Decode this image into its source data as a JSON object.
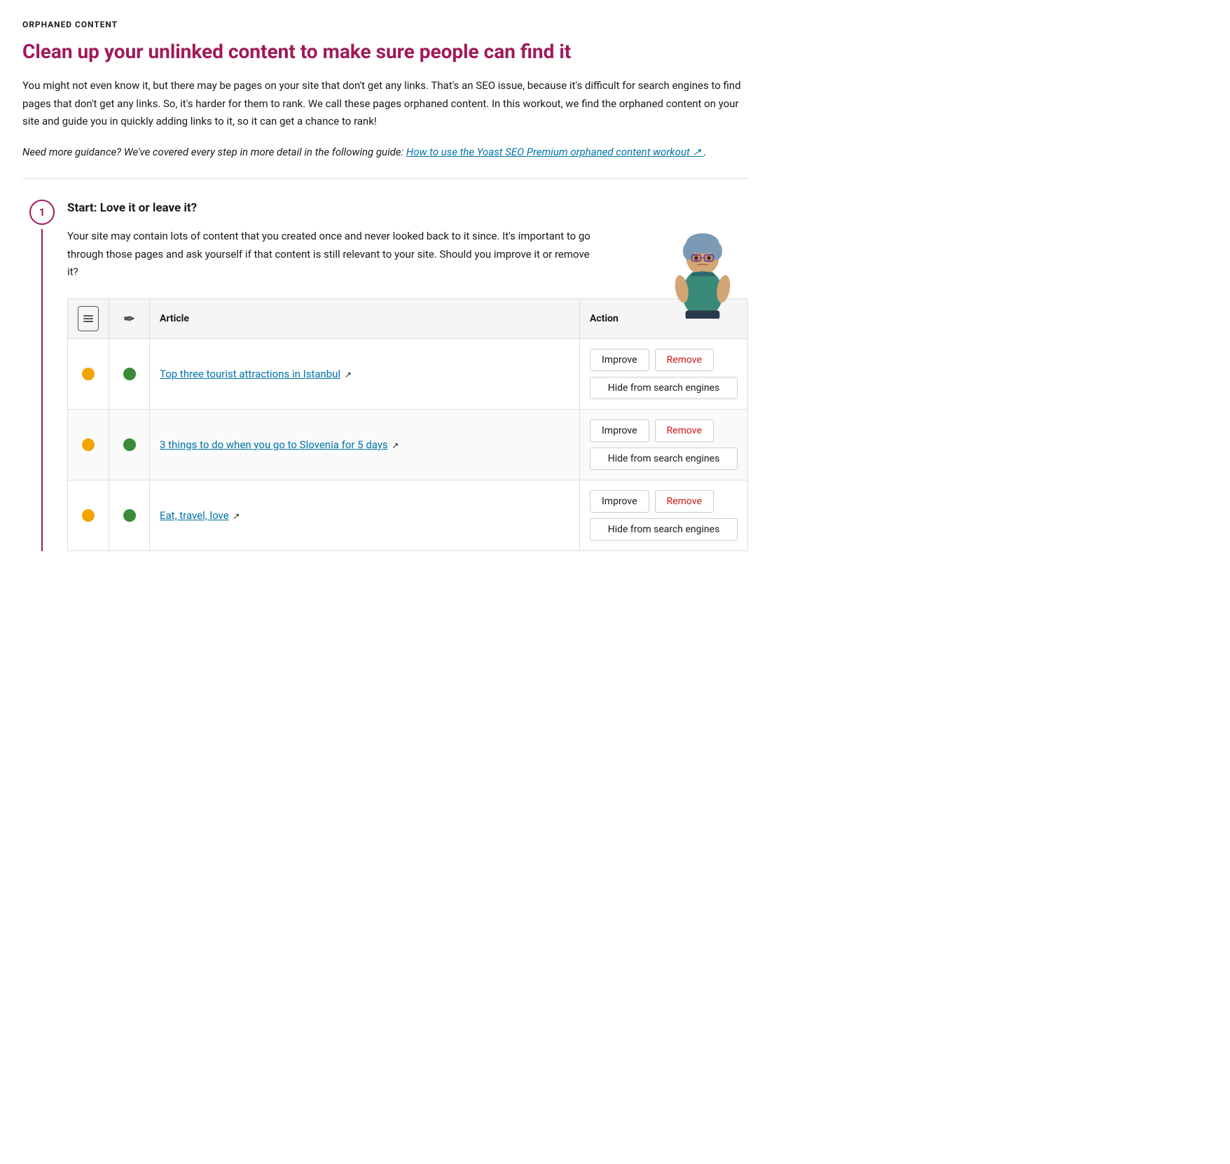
{
  "page": {
    "section_label": "ORPHANED CONTENT",
    "main_title": "Clean up your unlinked content to make sure people can find it",
    "intro_text": "You might not even know it, but there may be pages on your site that don't get any links. That's an SEO issue, because it's difficult for search engines to find pages that don't get any links. So, it's harder for them to rank. We call these pages orphaned content. In this workout, we find the orphaned content on your site and guide you in quickly adding links to it, so it can get a chance to rank!",
    "guidance_text": "Need more guidance? We've covered every step in more detail in the following guide:",
    "guidance_link_text": "How to use the Yoast SEO Premium orphaned content workout",
    "step": {
      "number": "1",
      "title": "Start: Love it or leave it?",
      "description": "Your site may contain lots of content that you created once and never looked back to it since. It's important to go through those pages and ask yourself if that content is still relevant to your site. Should you improve it or remove it?",
      "table": {
        "headers": {
          "seo": "seo-score",
          "readability": "readability-score",
          "article": "Article",
          "action": "Action"
        },
        "rows": [
          {
            "seo_dot": "orange",
            "readability_dot": "green",
            "article_link": "Top three tourist attractions in Istanbul",
            "article_href": "#",
            "btn_improve": "Improve",
            "btn_remove": "Remove",
            "btn_hide": "Hide from search engines"
          },
          {
            "seo_dot": "orange",
            "readability_dot": "green",
            "article_link": "3 things to do when you go to Slovenia for 5 days",
            "article_href": "#",
            "btn_improve": "Improve",
            "btn_remove": "Remove",
            "btn_hide": "Hide from search engines"
          },
          {
            "seo_dot": "orange",
            "readability_dot": "green",
            "article_link": "Eat, travel, love",
            "article_href": "#",
            "btn_improve": "Improve",
            "btn_remove": "Remove",
            "btn_hide": "Hide from search engines"
          }
        ]
      }
    }
  }
}
